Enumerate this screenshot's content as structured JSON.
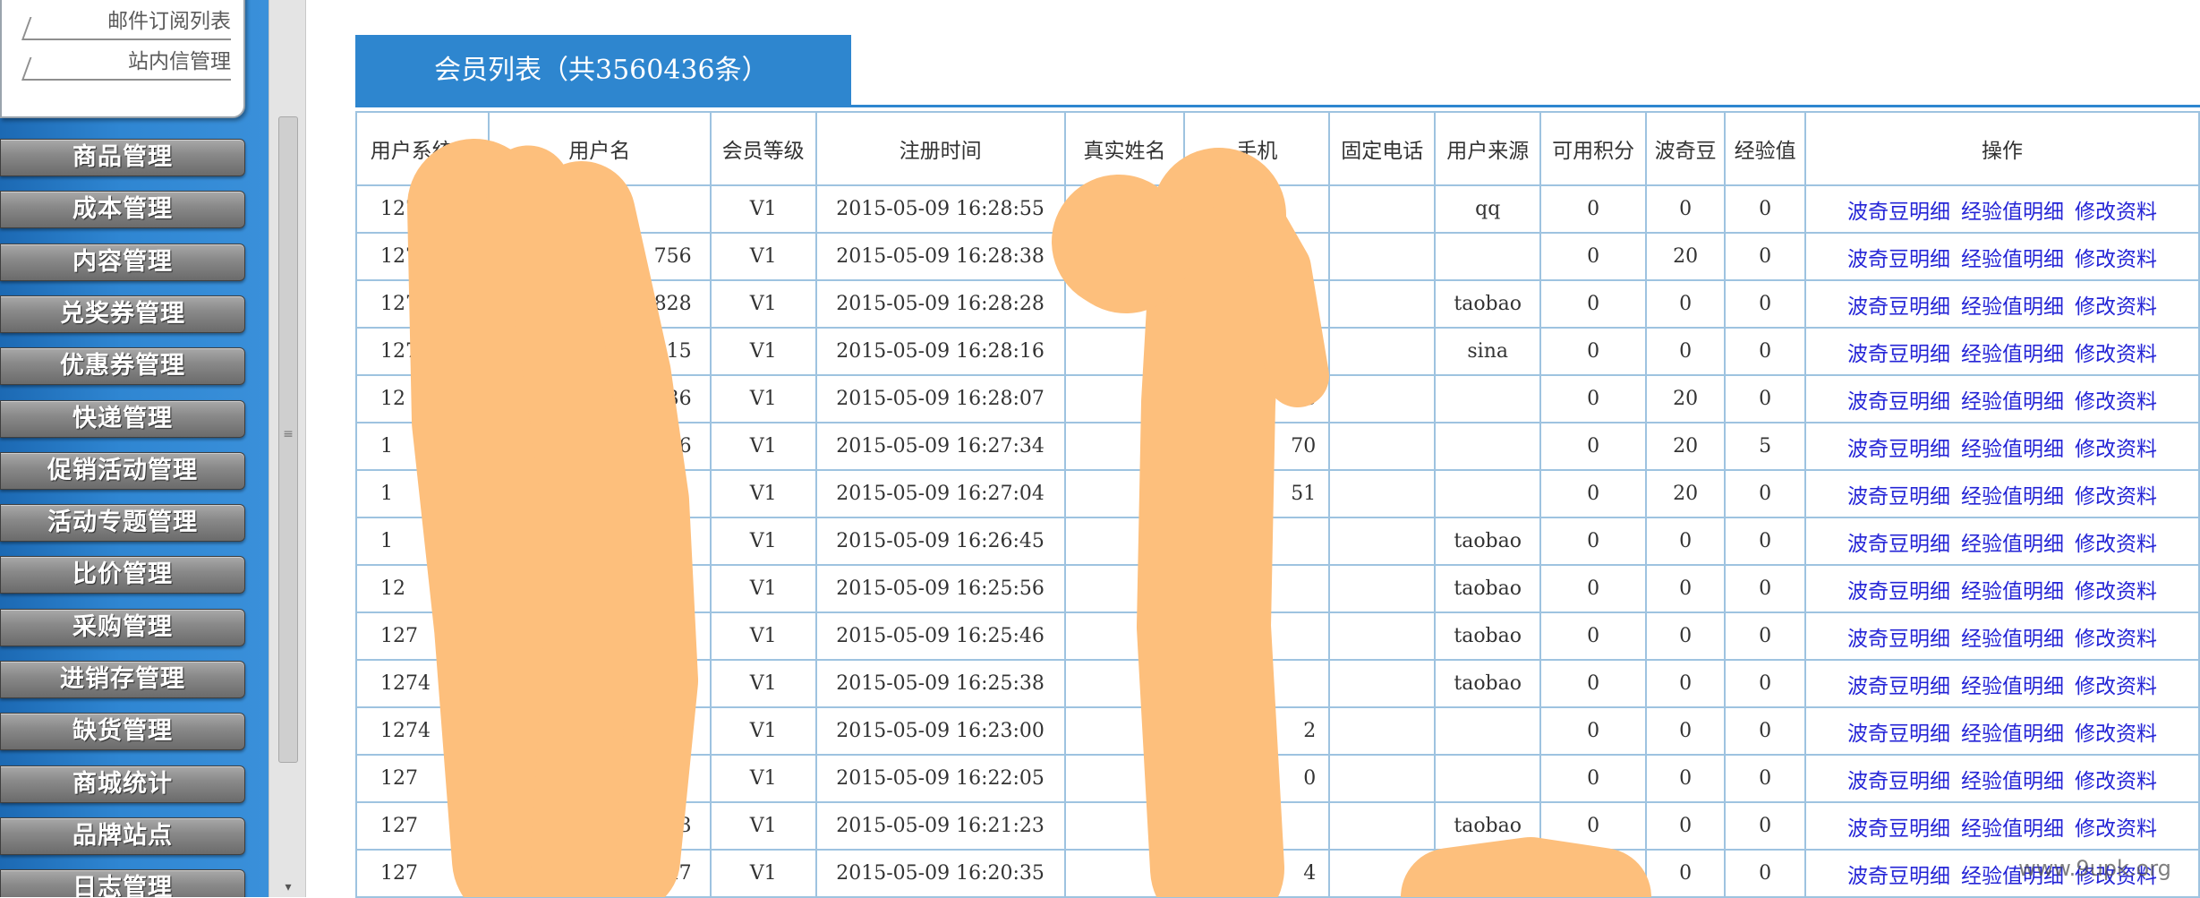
{
  "sidebar": {
    "submenu": [
      "邮件订阅列表",
      "站内信管理"
    ],
    "menu": [
      "商品管理",
      "成本管理",
      "内容管理",
      "兑奖券管理",
      "优惠券管理",
      "快递管理",
      "促销活动管理",
      "活动专题管理",
      "比价管理",
      "采购管理",
      "进销存管理",
      "缺货管理",
      "商城统计",
      "品牌站点",
      "日志管理"
    ]
  },
  "scrollbar": {
    "grip_glyph": "≡",
    "down_glyph": "▾"
  },
  "main": {
    "title": "会员列表（共3560436条）",
    "columns": [
      "用户系统ID",
      "用户名",
      "会员等级",
      "注册时间",
      "真实姓名",
      "手机",
      "固定电话",
      "用户来源",
      "可用积分",
      "波奇豆",
      "经验值",
      "操作"
    ],
    "op_labels": [
      "波奇豆明细",
      "经验值明细",
      "修改资料"
    ],
    "rows": [
      {
        "id": "1274",
        "name": "",
        "level": "V1",
        "reg_time": "2015-05-09 16:28:55",
        "real_name": "",
        "phone": "",
        "tel": "",
        "source": "qq",
        "points": "0",
        "beans": "0",
        "exp": "0"
      },
      {
        "id": "127",
        "name": "756",
        "level": "V1",
        "reg_time": "2015-05-09 16:28:38",
        "real_name": "",
        "phone": "",
        "tel": "",
        "source": "",
        "points": "0",
        "beans": "20",
        "exp": "0"
      },
      {
        "id": "127",
        "name": "2828",
        "level": "V1",
        "reg_time": "2015-05-09 16:28:28",
        "real_name": "",
        "phone": "",
        "tel": "",
        "source": "taobao",
        "points": "0",
        "beans": "0",
        "exp": "0"
      },
      {
        "id": "127",
        "name": "315",
        "level": "V1",
        "reg_time": "2015-05-09 16:28:16",
        "real_name": "",
        "phone": "",
        "tel": "",
        "source": "sina",
        "points": "0",
        "beans": "0",
        "exp": "0"
      },
      {
        "id": "12",
        "name": "636",
        "level": "V1",
        "reg_time": "2015-05-09 16:28:07",
        "real_name": "",
        "phone": "98",
        "tel": "",
        "source": "",
        "points": "0",
        "beans": "20",
        "exp": "0"
      },
      {
        "id": "1",
        "name": "6",
        "level": "V1",
        "reg_time": "2015-05-09 16:27:34",
        "real_name": "",
        "phone": "70",
        "tel": "",
        "source": "",
        "points": "0",
        "beans": "20",
        "exp": "5"
      },
      {
        "id": "1",
        "name": "",
        "level": "V1",
        "reg_time": "2015-05-09 16:27:04",
        "real_name": "",
        "phone": "51",
        "tel": "",
        "source": "",
        "points": "0",
        "beans": "20",
        "exp": "0"
      },
      {
        "id": "1",
        "name": "",
        "level": "V1",
        "reg_time": "2015-05-09 16:26:45",
        "real_name": "",
        "phone": "",
        "tel": "",
        "source": "taobao",
        "points": "0",
        "beans": "0",
        "exp": "0"
      },
      {
        "id": "12",
        "name": "",
        "level": "V1",
        "reg_time": "2015-05-09 16:25:56",
        "real_name": "",
        "phone": "",
        "tel": "",
        "source": "taobao",
        "points": "0",
        "beans": "0",
        "exp": "0"
      },
      {
        "id": "127",
        "name": "",
        "level": "V1",
        "reg_time": "2015-05-09 16:25:46",
        "real_name": "",
        "phone": "",
        "tel": "",
        "source": "taobao",
        "points": "0",
        "beans": "0",
        "exp": "0"
      },
      {
        "id": "1274",
        "name": "",
        "level": "V1",
        "reg_time": "2015-05-09 16:25:38",
        "real_name": "",
        "phone": "",
        "tel": "",
        "source": "taobao",
        "points": "0",
        "beans": "0",
        "exp": "0"
      },
      {
        "id": "1274",
        "name": "",
        "level": "V1",
        "reg_time": "2015-05-09 16:23:00",
        "real_name": "",
        "phone": "2",
        "tel": "",
        "source": "",
        "points": "0",
        "beans": "0",
        "exp": "0"
      },
      {
        "id": "127",
        "name": "",
        "level": "V1",
        "reg_time": "2015-05-09 16:22:05",
        "real_name": "",
        "phone": "0",
        "tel": "",
        "source": "",
        "points": "0",
        "beans": "0",
        "exp": "0"
      },
      {
        "id": "127",
        "name": "3",
        "level": "V1",
        "reg_time": "2015-05-09 16:21:23",
        "real_name": "",
        "phone": "",
        "tel": "",
        "source": "taobao",
        "points": "0",
        "beans": "0",
        "exp": "0"
      },
      {
        "id": "127",
        "name": "547",
        "level": "V1",
        "reg_time": "2015-05-09 16:20:35",
        "real_name": "",
        "phone": "4",
        "tel": "",
        "source": "",
        "points": "0",
        "beans": "0",
        "exp": "0"
      }
    ]
  },
  "redaction_color": "#fdbf7c",
  "accent_color": "#2e86cf",
  "link_color": "#2424d6",
  "watermark": "www.9upk.org"
}
